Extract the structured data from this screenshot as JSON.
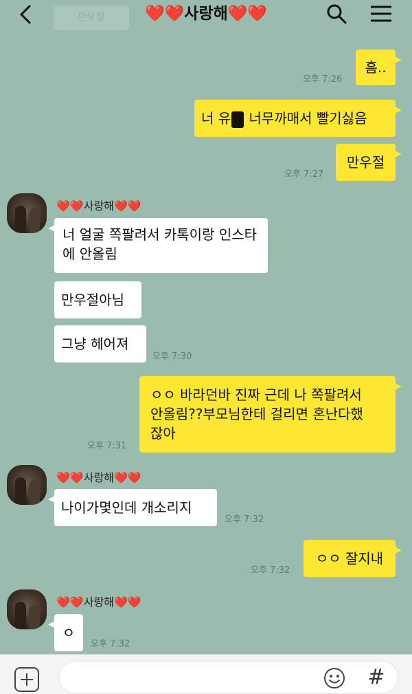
{
  "header": {
    "title_heart_left": "❤️❤️",
    "title_text": "사랑해",
    "title_heart_right": "❤️❤️",
    "notice_text": "만우절"
  },
  "messages": {
    "m1": {
      "text": "흠..",
      "time": "오후 7:26"
    },
    "m2": {
      "text_a": "너 유",
      "text_b": " 너무까매서 빨기싫음"
    },
    "m3": {
      "text": "만우절",
      "time": "오후 7:27"
    },
    "g1": {
      "sender": "❤️❤️사랑해❤️❤️",
      "line1": "너 얼굴 쪽팔려서 카톡이랑 인스타",
      "line2": "에 안올림",
      "msg2": "만우절아님",
      "msg3": "그냥 헤어져",
      "time": "오후 7:30"
    },
    "m4": {
      "line1": "ㅇㅇ 바라던바 진짜 근데 나 쪽팔려서",
      "line2": "안올림??부모님한테 걸리면 혼난다했",
      "line3": "잖아",
      "time": "오후 7:31"
    },
    "g2": {
      "sender": "❤️❤️사랑해❤️❤️",
      "text": "나이가몇인데 개소리지",
      "time": "오후 7:32"
    },
    "m5": {
      "text": "ㅇㅇ 잘지내",
      "time": "오후 7:32"
    },
    "g3": {
      "sender": "❤️❤️사랑해❤️❤️",
      "text": "ㅇ",
      "time": "오후 7:32"
    }
  },
  "input": {
    "hash_label": "#"
  },
  "colors": {
    "background": "#9bbbae",
    "my_bubble": "#fde733",
    "other_bubble": "#ffffff",
    "heart": "#e22a2a"
  },
  "icons": [
    "back-arrow-icon",
    "search-icon",
    "menu-icon",
    "plus-icon",
    "emoji-icon",
    "hash-icon"
  ]
}
